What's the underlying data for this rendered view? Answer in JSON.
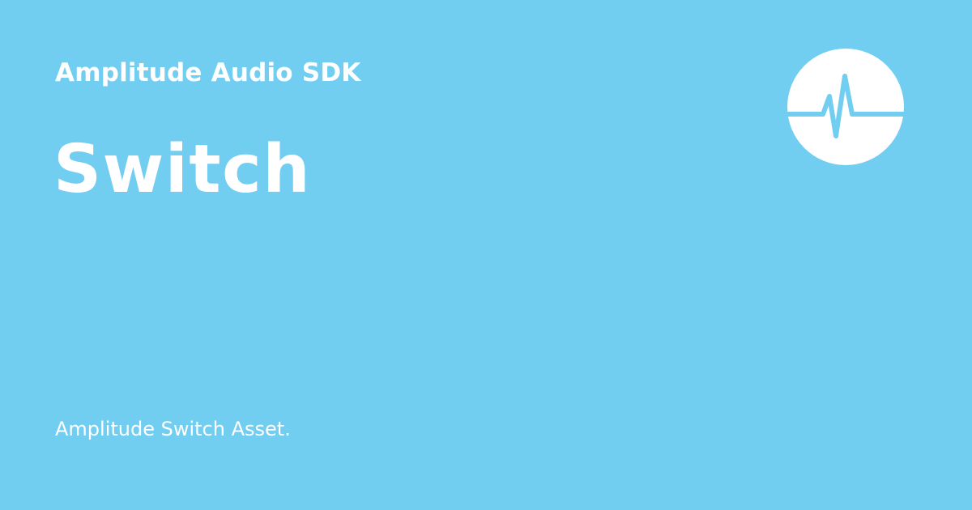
{
  "header": {
    "site_name": "Amplitude Audio SDK"
  },
  "page": {
    "title": "Switch",
    "description": "Amplitude Switch Asset."
  },
  "logo": {
    "icon": "pulse-waveform-icon"
  },
  "colors": {
    "background": "#72cef1",
    "foreground": "#ffffff"
  }
}
